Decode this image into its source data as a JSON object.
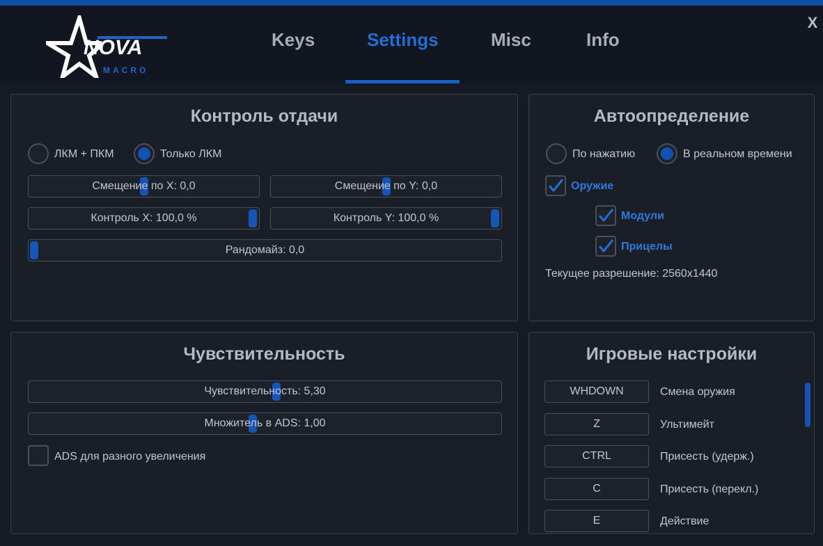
{
  "logo": {
    "name": "NOVA",
    "sub": "MACRO"
  },
  "window": {
    "close_label": "X"
  },
  "tabs": [
    {
      "label": "Keys"
    },
    {
      "label": "Settings",
      "active": true
    },
    {
      "label": "Misc"
    },
    {
      "label": "Info"
    }
  ],
  "recoil": {
    "title": "Контроль отдачи",
    "mode_options": [
      {
        "label": "ЛКМ + ПКМ",
        "selected": false
      },
      {
        "label": "Только ЛКМ",
        "selected": true
      }
    ],
    "offset_x": {
      "label": "Смещение по X: 0,0",
      "value": 0.5
    },
    "offset_y": {
      "label": "Смещение по Y: 0,0",
      "value": 0.5
    },
    "control_x": {
      "label": "Контроль X: 100,0 %",
      "value": 1.0
    },
    "control_y": {
      "label": "Контроль Y: 100,0 %",
      "value": 1.0
    },
    "randomize": {
      "label": "Рандомайз: 0,0",
      "value": 0.0
    }
  },
  "auto": {
    "title": "Автоопределение",
    "options": [
      {
        "label": "По нажатию",
        "selected": false
      },
      {
        "label": "В реальном времени",
        "selected": true
      }
    ],
    "weapons": {
      "label": "Оружие",
      "checked": true
    },
    "modules": {
      "label": "Модули",
      "checked": true
    },
    "scopes": {
      "label": "Прицелы",
      "checked": true
    },
    "resolution": "Текущее разрешение: 2560x1440"
  },
  "sensitivity": {
    "title": "Чувствительность",
    "sens": {
      "label": "Чувствительность: 5,30",
      "value": 0.53
    },
    "ads_mult": {
      "label": "Множитель в ADS: 1,00",
      "value": 0.47
    },
    "ads_zoom": {
      "label": "ADS для разного увеличения",
      "checked": false
    }
  },
  "game": {
    "title": "Игровые настройки",
    "binds": [
      {
        "key": "WHDOWN",
        "action": "Смена оружия"
      },
      {
        "key": "Z",
        "action": "Ультимейт"
      },
      {
        "key": "CTRL",
        "action": "Присесть (удерж.)"
      },
      {
        "key": "C",
        "action": "Присесть (перекл.)"
      },
      {
        "key": "E",
        "action": "Действие"
      }
    ]
  },
  "colors": {
    "accent": "#1f6fd6",
    "panel": "#1a1e27",
    "background": "#161a22"
  }
}
